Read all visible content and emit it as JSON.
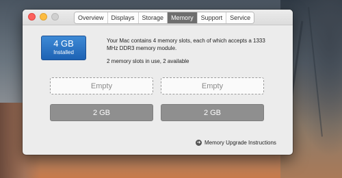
{
  "window": {
    "tabs": [
      {
        "label": "Overview",
        "active": false
      },
      {
        "label": "Displays",
        "active": false
      },
      {
        "label": "Storage",
        "active": false
      },
      {
        "label": "Memory",
        "active": true
      },
      {
        "label": "Support",
        "active": false
      },
      {
        "label": "Service",
        "active": false
      }
    ]
  },
  "memory": {
    "installed_size": "4 GB",
    "installed_label": "Installed",
    "description": "Your Mac contains 4 memory slots, each of which accepts a 1333 MHz DDR3 memory module.",
    "slots_summary": "2 memory slots in use, 2 available",
    "slots": [
      {
        "label": "Empty",
        "state": "empty"
      },
      {
        "label": "Empty",
        "state": "empty"
      },
      {
        "label": "2 GB",
        "state": "filled"
      },
      {
        "label": "2 GB",
        "state": "filled"
      }
    ],
    "upgrade_link": "Memory Upgrade Instructions",
    "upgrade_icon": "arrow-right-circle-icon"
  },
  "colors": {
    "installed_badge": "#2a73c5",
    "active_tab": "#6e6e6e",
    "filled_slot": "#8f8f8f"
  }
}
